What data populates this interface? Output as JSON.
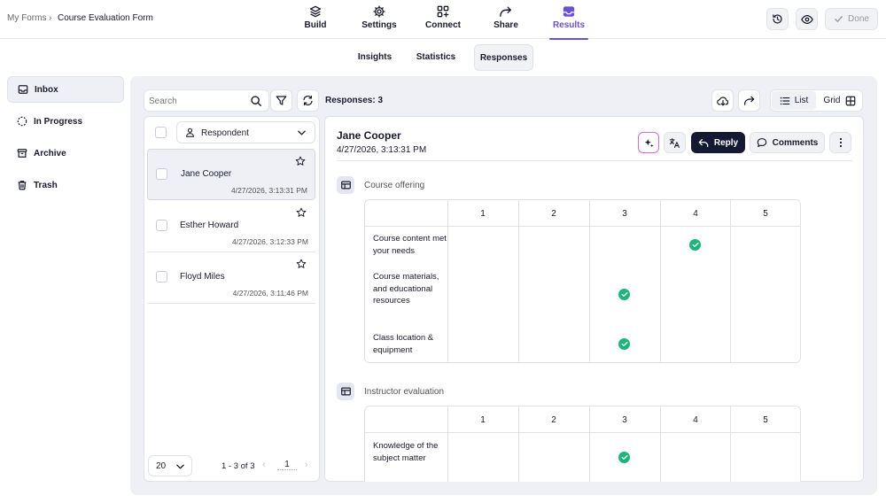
{
  "breadcrumb": {
    "parent": "My Forms",
    "separator": "›",
    "current": "Course Evaluation Form"
  },
  "nav_tabs": [
    {
      "label": "Build"
    },
    {
      "label": "Settings"
    },
    {
      "label": "Connect"
    },
    {
      "label": "Share"
    },
    {
      "label": "Results",
      "active": true
    }
  ],
  "top_actions": {
    "done_label": "Done"
  },
  "sub_tabs": [
    {
      "label": "Insights"
    },
    {
      "label": "Statistics"
    },
    {
      "label": "Responses",
      "active": true
    }
  ],
  "sidebar": {
    "items": [
      {
        "label": "Inbox",
        "icon": "inbox-icon",
        "active": true
      },
      {
        "label": "In Progress",
        "icon": "dashed-circle-icon"
      },
      {
        "label": "Archive",
        "icon": "archive-icon"
      },
      {
        "label": "Trash",
        "icon": "trash-icon"
      }
    ]
  },
  "toolbar": {
    "search_placeholder": "Search",
    "responses_count_label": "Responses: 3",
    "list_label": "List",
    "grid_label": "Grid"
  },
  "list": {
    "filter_label": "Respondent",
    "items": [
      {
        "name": "Jane Cooper",
        "date": "4/27/2026, 3:13:31 PM",
        "selected": true
      },
      {
        "name": "Esther Howard",
        "date": "4/27/2026, 3:12:33 PM"
      },
      {
        "name": "Floyd Miles",
        "date": "4/27/2026, 3:11:46 PM"
      }
    ],
    "pagination": {
      "page_size": "20",
      "range": "1 - 3 of 3",
      "page": "1"
    }
  },
  "detail": {
    "name": "Jane Cooper",
    "date": "4/27/2026, 3:13:31 PM",
    "reply_label": "Reply",
    "comments_label": "Comments",
    "sections": [
      {
        "title": "Course offering",
        "columns": [
          "1",
          "2",
          "3",
          "4",
          "5"
        ],
        "rows": [
          {
            "label": "Course content met your needs",
            "selected": 4
          },
          {
            "label": "Course materials, and educational resources",
            "selected": 3
          },
          {
            "label": "Class location & equipment",
            "selected": 3
          }
        ]
      },
      {
        "title": "Instructor evaluation",
        "columns": [
          "1",
          "2",
          "3",
          "4",
          "5"
        ],
        "rows": [
          {
            "label": "Knowledge of the subject matter",
            "selected": 3
          }
        ]
      }
    ]
  },
  "colors": {
    "accent": "#6c4fd9",
    "check": "#1bb77a",
    "panel_bg": "#eef0f6",
    "reply_bg": "#141a33"
  }
}
